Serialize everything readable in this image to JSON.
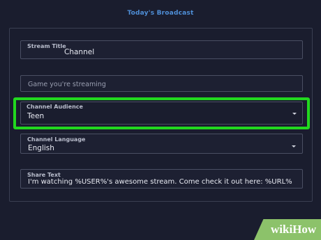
{
  "header": {
    "title": "Today's Broadcast"
  },
  "form": {
    "stream_title": {
      "label": "Stream Title",
      "value": "Channel"
    },
    "game": {
      "placeholder": "Game you're streaming"
    },
    "audience": {
      "label": "Channel Audience",
      "value": "Teen"
    },
    "language": {
      "label": "Channel Language",
      "value": "English"
    },
    "share_text": {
      "label": "Share Text",
      "value": "I'm watching %USER%'s awesome stream. Come check it out here: %URL%"
    }
  },
  "watermark": {
    "text": "wikiHow"
  },
  "colors": {
    "background": "#1a1d2e",
    "title_accent": "#4f8fd8",
    "highlight": "#22d81f",
    "field_border": "#4a4f63",
    "watermark_bg": "#8cc26a"
  },
  "icons": {
    "dropdown": "chevron-down-icon"
  }
}
